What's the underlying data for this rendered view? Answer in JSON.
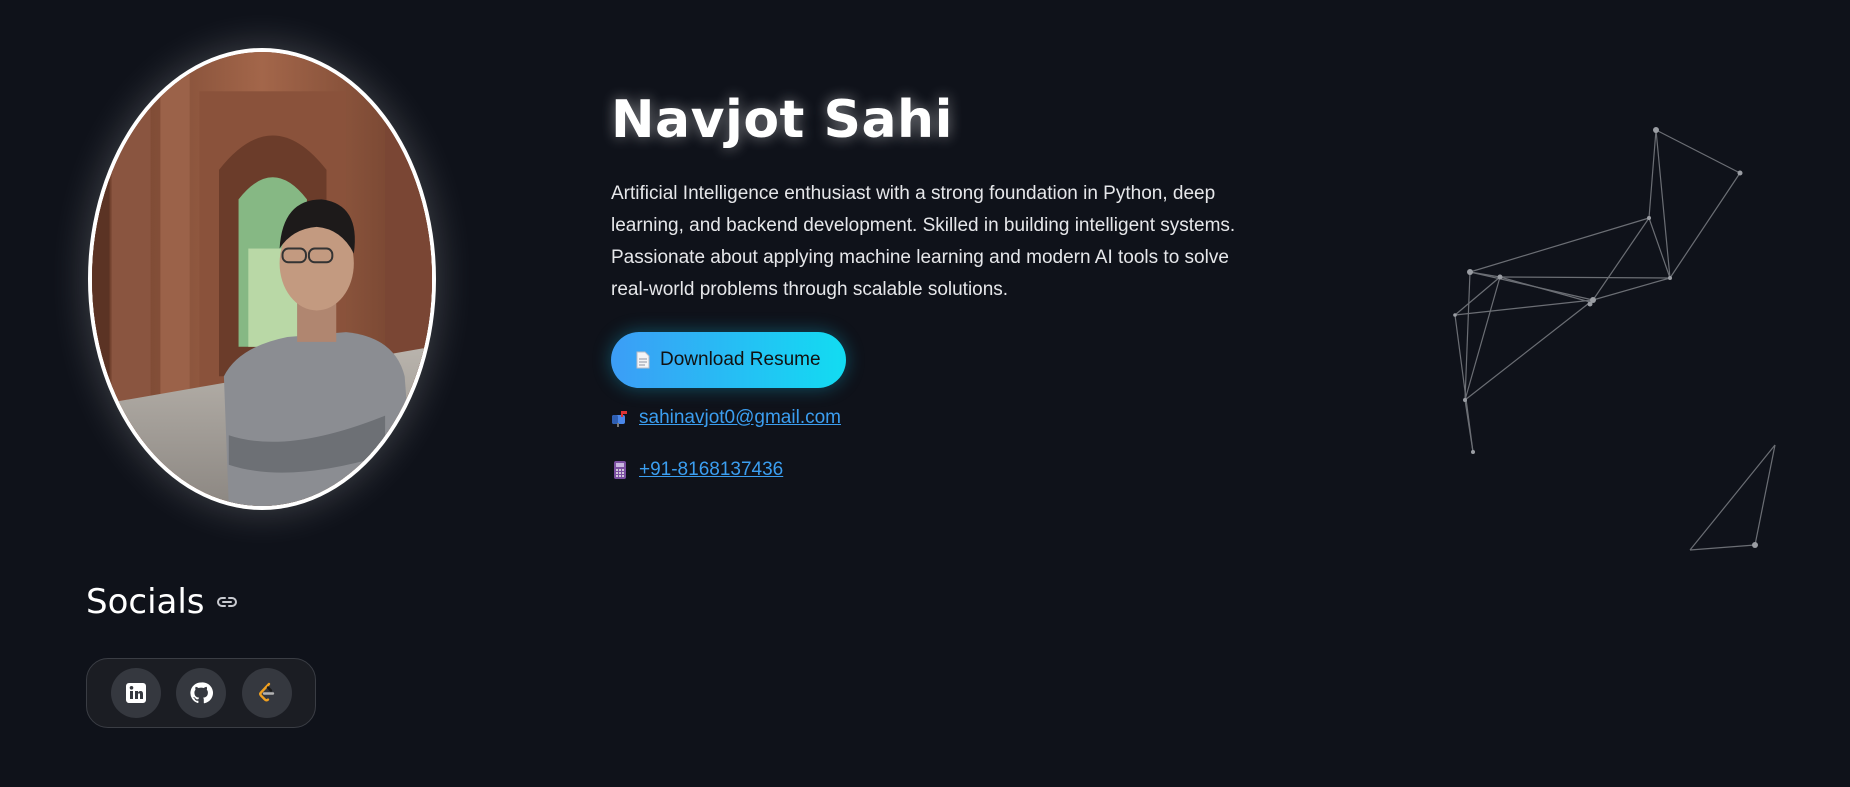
{
  "profile": {
    "name": "Navjot Sahi",
    "bio": "Artificial Intelligence enthusiast with a strong foundation in Python, deep learning, and backend development. Skilled in building intelligent systems. Passionate about applying machine learning and modern AI tools to solve real-world problems through scalable solutions.",
    "photo_icon": "profile-photo"
  },
  "actions": {
    "resume_label": "Download Resume",
    "resume_icon": "document-icon"
  },
  "contacts": {
    "email": "sahinavjot0@gmail.com",
    "email_icon": "mailbox-icon",
    "phone": "+91-8168137436",
    "phone_icon": "phone-icon"
  },
  "socials": {
    "title": "Socials",
    "title_icon": "link-icon",
    "items": [
      {
        "name": "linkedin",
        "icon": "linkedin-icon"
      },
      {
        "name": "github",
        "icon": "github-icon"
      },
      {
        "name": "leetcode",
        "icon": "leetcode-icon"
      }
    ]
  },
  "colors": {
    "background": "#0f121a",
    "link": "#3b9ef0",
    "button_gradient_start": "#3c9df6",
    "button_gradient_end": "#12dcf2"
  }
}
